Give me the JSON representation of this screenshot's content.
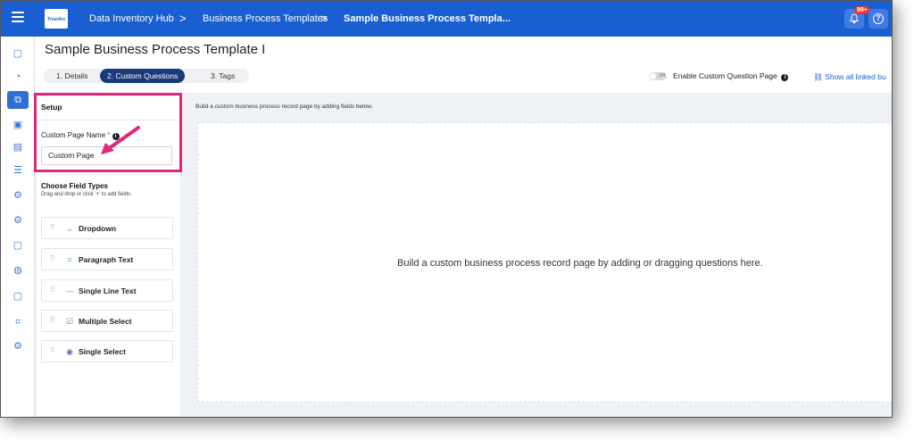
{
  "topbar": {
    "breadcrumbs": [
      "Data Inventory Hub",
      "Business Process Templates",
      "Sample Business Process Templa..."
    ],
    "separator": ">",
    "notification_count": "99+",
    "logo_text": "TrustArc",
    "help_symbol": "?"
  },
  "page": {
    "title": "Sample Business Process Template I",
    "steps": [
      "1. Details",
      "2. Custom Questions",
      "3. Tags"
    ],
    "active_step": 1,
    "toggle_state": "Off",
    "toggle_label": "Enable Custom Question Page",
    "show_linked": "Show all linked bu",
    "info_symbol": "i"
  },
  "setup": {
    "heading": "Setup",
    "custom_page_name_label": "Custom Page Name",
    "required_mark": "*",
    "custom_page_name_value": "Custom Page",
    "choose_field_types": "Choose Field Types",
    "choose_field_hint": "Drag and drop or click '+' to add fields.",
    "fields": [
      {
        "label": "Dropdown",
        "icon": "chevron-down-icon"
      },
      {
        "label": "Paragraph Text",
        "icon": "paragraph-icon"
      },
      {
        "label": "Single Line Text",
        "icon": "single-line-icon"
      },
      {
        "label": "Multiple Select",
        "icon": "checkbox-icon"
      },
      {
        "label": "Single Select",
        "icon": "radio-icon"
      }
    ]
  },
  "canvas": {
    "hint": "Build a custom business process record page by adding fields below.",
    "empty_message": "Build a custom business process record page by adding or dragging questions here."
  },
  "colors": {
    "topbar": "#1a5fd1",
    "active_step": "#183a78",
    "highlight": "#e0267c",
    "link": "#1a5fd1"
  }
}
